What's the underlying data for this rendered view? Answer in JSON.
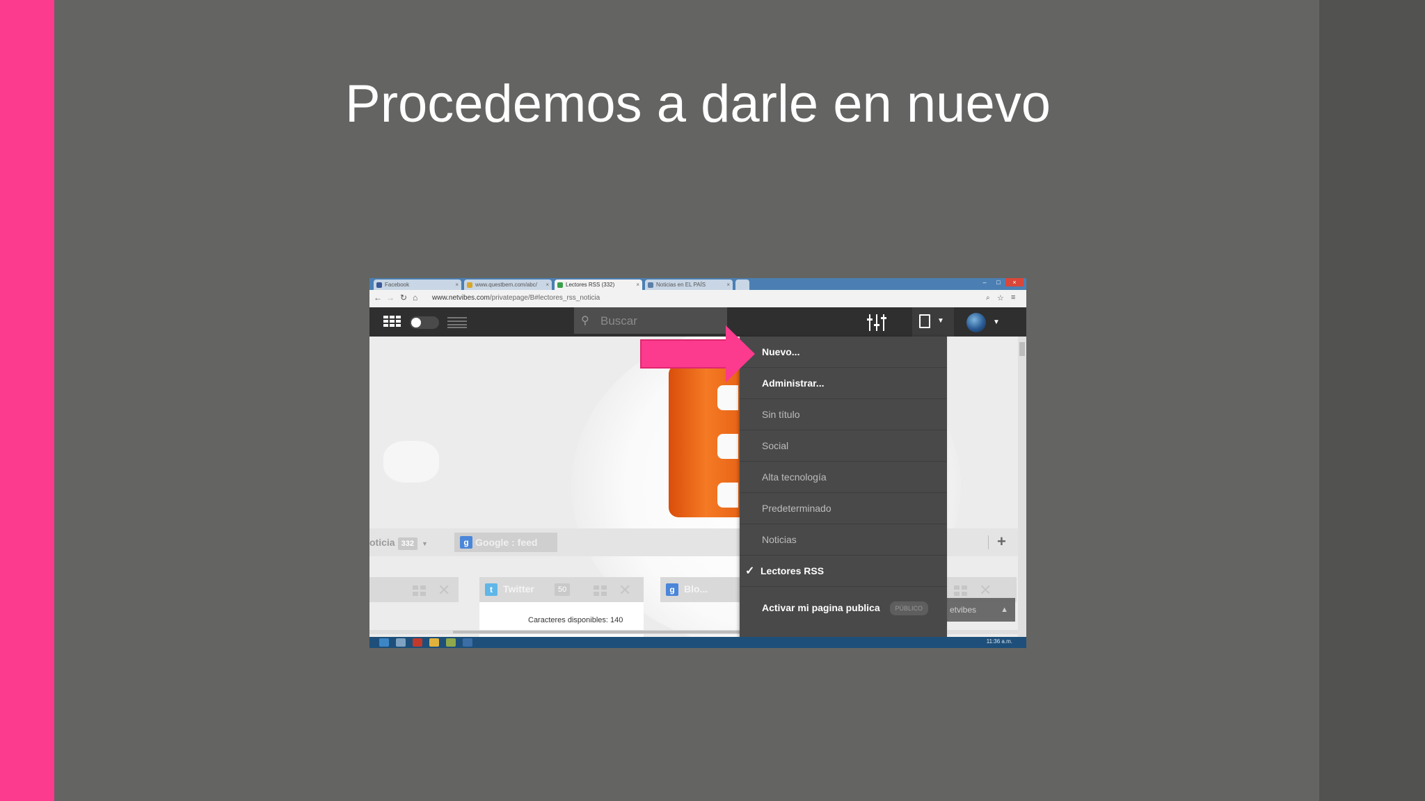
{
  "slide": {
    "title": "Procedemos a darle en nuevo"
  },
  "browser": {
    "tabs": [
      {
        "label": "Facebook",
        "icon_color": "#3b5998"
      },
      {
        "label": "www.questbem.com/abc/",
        "icon_color": "#d8a72a"
      },
      {
        "label": "Lectores RSS (332)",
        "icon_color": "#3aa04a",
        "active": true
      },
      {
        "label": "Noticias en EL PAÍS",
        "icon_color": "#5b7fa8"
      }
    ],
    "url_domain": "www.netvibes.com",
    "url_path": "/privatepage/B#lectores_rss_noticia"
  },
  "app": {
    "search_placeholder": "Buscar",
    "tabs": [
      {
        "label": "oticia",
        "count": "332"
      },
      {
        "label": "Google : feed",
        "icon": "g-icon"
      }
    ],
    "add_tab": "+",
    "widgets": [
      {
        "title": "Twitter",
        "count": "50"
      },
      {
        "title": "Blo..."
      }
    ],
    "chars_available": "Caracteres disponibles: 140",
    "netvibes_chip": "etvibes"
  },
  "dropdown_menu": {
    "items": [
      {
        "label": "Nuevo...",
        "style": "bold"
      },
      {
        "label": "Administrar...",
        "style": "bold"
      },
      {
        "label": "Sin título",
        "style": "normal"
      },
      {
        "label": "Social",
        "style": "normal"
      },
      {
        "label": "Alta tecnología",
        "style": "normal"
      },
      {
        "label": "Predeterminado",
        "style": "normal"
      },
      {
        "label": "Noticias",
        "style": "normal"
      },
      {
        "label": "Lectores RSS",
        "style": "checked"
      }
    ],
    "publish": {
      "label": "Activar mi pagina publica",
      "badge": "PÚBLICO"
    }
  },
  "taskbar": {
    "clock": "11:36 a.m."
  },
  "colors": {
    "accent_pink": "#fc3a8e",
    "slide_bg": "#646462",
    "menu_bg": "#494949",
    "taskbar": "#1d4f7a"
  }
}
